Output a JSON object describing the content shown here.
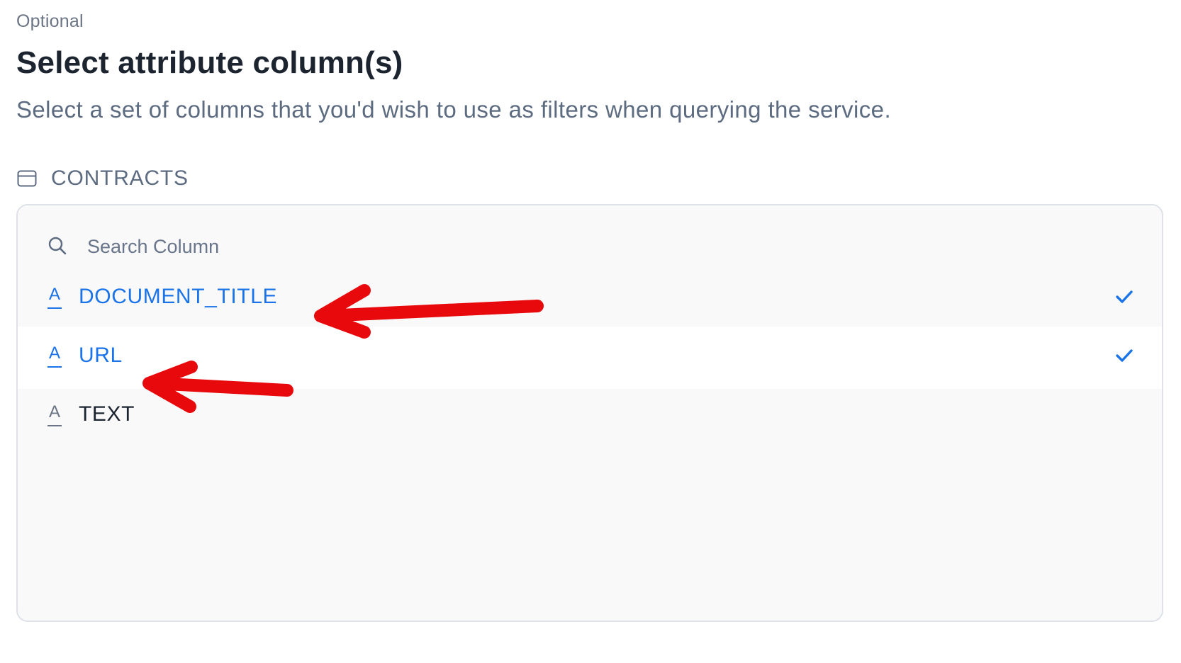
{
  "header": {
    "optional_label": "Optional",
    "title": "Select attribute column(s)",
    "subtitle": "Select a set of columns that you'd wish to use as filters when querying the service."
  },
  "table": {
    "icon": "table-icon",
    "name": "CONTRACTS"
  },
  "search": {
    "icon": "search-icon",
    "placeholder": "Search Column",
    "value": ""
  },
  "columns": [
    {
      "name": "DOCUMENT_TITLE",
      "type_icon": "text-type-icon",
      "selected": true
    },
    {
      "name": "URL",
      "type_icon": "text-type-icon",
      "selected": true
    },
    {
      "name": "TEXT",
      "type_icon": "text-type-icon",
      "selected": false
    }
  ],
  "colors": {
    "selected": "#1a73e8",
    "title": "#1c2430",
    "muted": "#5c6b80",
    "annotation_arrow": "#e8090c"
  },
  "annotations": [
    {
      "type": "arrow",
      "points_to": "DOCUMENT_TITLE"
    },
    {
      "type": "arrow",
      "points_to": "URL"
    }
  ]
}
